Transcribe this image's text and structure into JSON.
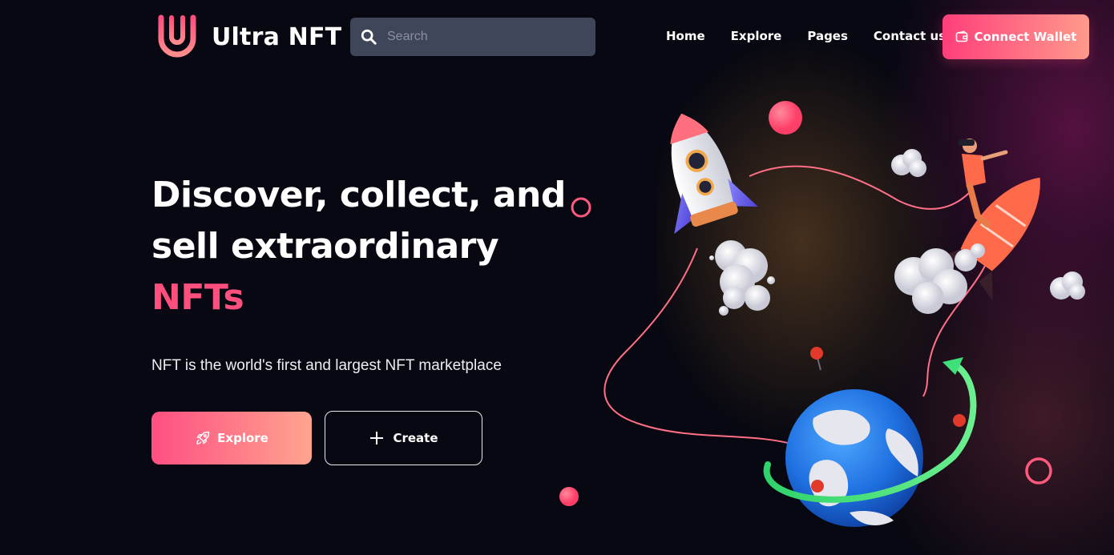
{
  "brand": {
    "name": "Ultra NFT",
    "logo_icon": "ultra-u-logo",
    "accent": "#ff4f7f"
  },
  "search": {
    "placeholder": "Search",
    "value": "",
    "icon": "search-icon"
  },
  "nav": {
    "items": [
      {
        "label": "Home"
      },
      {
        "label": "Explore"
      },
      {
        "label": "Pages"
      },
      {
        "label": "Contact us"
      }
    ]
  },
  "header": {
    "connect_label": "Connect Wallet",
    "connect_icon": "wallet-icon"
  },
  "hero": {
    "title_line1": "Discover, collect, and",
    "title_line2": "sell extraordinary",
    "title_accent": "NFTs",
    "subtitle": "NFT is the world's first and largest NFT marketplace",
    "explore_label": "Explore",
    "explore_icon": "rocket-icon",
    "create_label": "Create",
    "create_icon": "plus-icon"
  },
  "colors": {
    "background": "#070811",
    "search_bg": "#3f4659",
    "gradient_start": "#ff3f7a",
    "gradient_end": "#ff9a8c",
    "text": "#ffffff"
  }
}
